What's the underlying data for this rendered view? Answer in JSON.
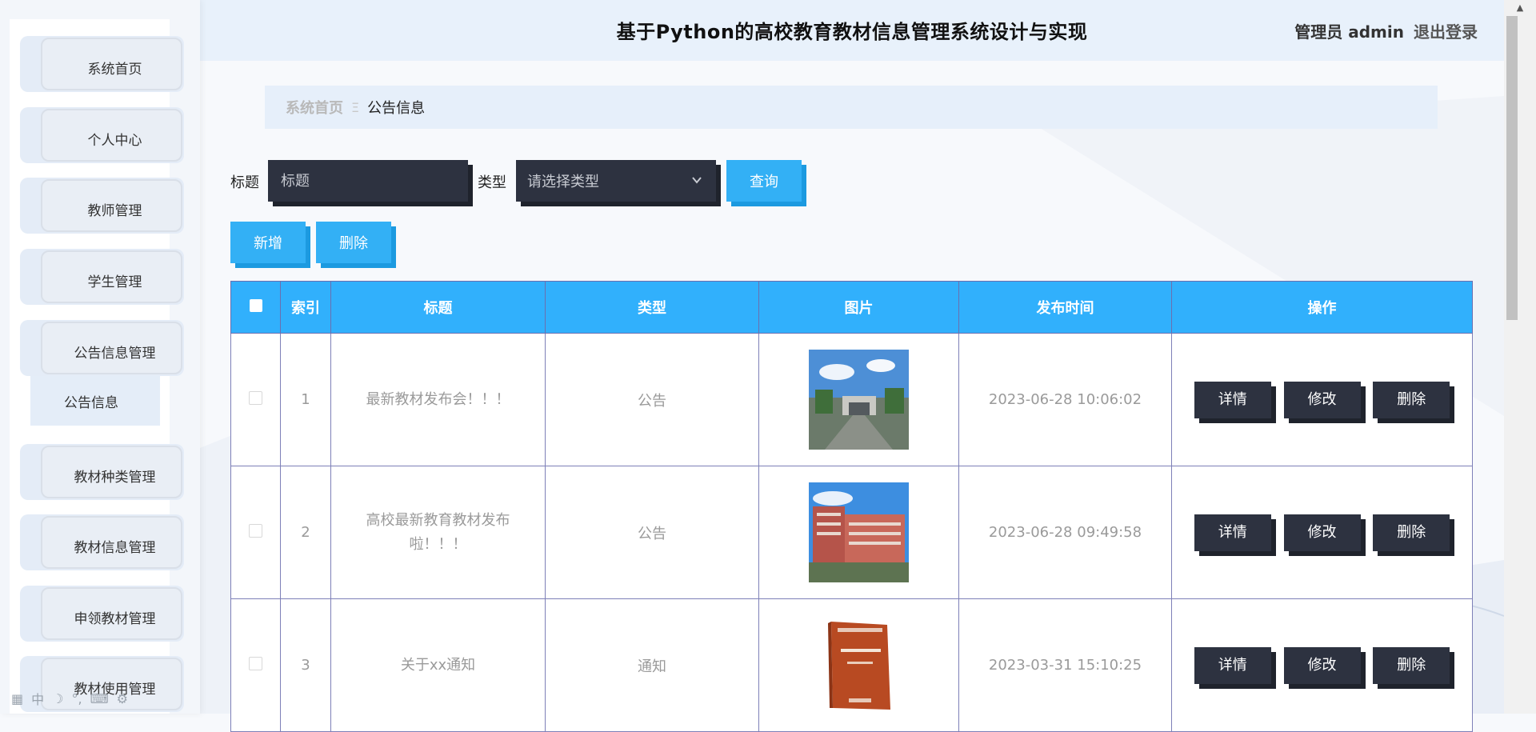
{
  "header": {
    "title": "基于Python的高校教育教材信息管理系统设计与实现",
    "user": "管理员 admin",
    "logout": "退出登录"
  },
  "sidebar": {
    "items": [
      {
        "label": "系统首页"
      },
      {
        "label": "个人中心"
      },
      {
        "label": "教师管理"
      },
      {
        "label": "学生管理"
      },
      {
        "label": "公告信息管理"
      },
      {
        "label": "教材种类管理"
      },
      {
        "label": "教材信息管理"
      },
      {
        "label": "申领教材管理"
      },
      {
        "label": "教材使用管理"
      }
    ],
    "submenu_label": "公告信息"
  },
  "breadcrumb": {
    "home": "系统首页",
    "separator": "Ξ",
    "current": "公告信息"
  },
  "search": {
    "title_label": "标题",
    "title_placeholder": "标题",
    "type_label": "类型",
    "type_placeholder": "请选择类型",
    "query_button": "查询"
  },
  "actions": {
    "add": "新增",
    "delete": "删除"
  },
  "table": {
    "columns": [
      "索引",
      "标题",
      "类型",
      "图片",
      "发布时间",
      "操作"
    ],
    "rows": [
      {
        "index": "1",
        "title": "最新教材发布会！！！",
        "type": "公告",
        "image": "campus-gate-photo",
        "time": "2023-06-28 10:06:02"
      },
      {
        "index": "2",
        "title": "高校最新教育教材发布啦！！！",
        "type": "公告",
        "image": "campus-building-photo",
        "time": "2023-06-28 09:49:58"
      },
      {
        "index": "3",
        "title": "关于xx通知",
        "type": "通知",
        "image": "textbook-cover-photo",
        "time": "2023-03-31 15:10:25"
      }
    ],
    "row_actions": {
      "detail": "详情",
      "edit": "修改",
      "delete": "删除"
    }
  },
  "colors": {
    "accent_blue": "#33b0f5",
    "dark_button": "#2d3240",
    "header_bg": "#e8f1fb"
  }
}
